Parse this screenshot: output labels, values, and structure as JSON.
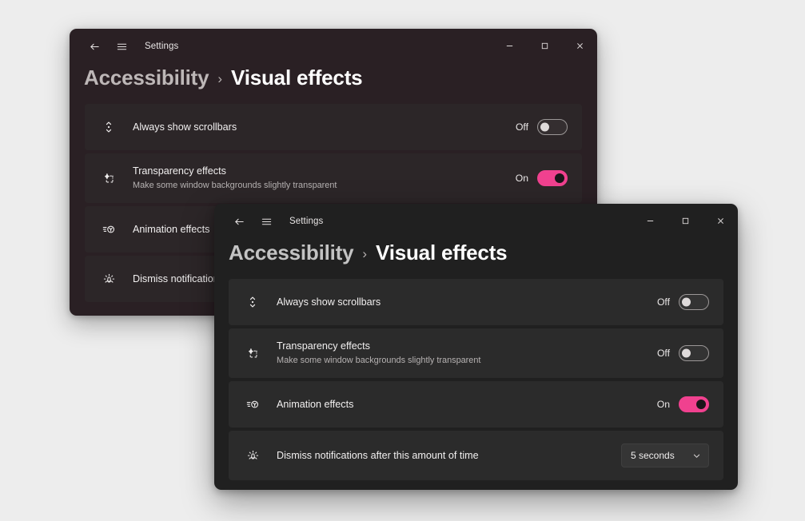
{
  "page": {
    "background_color": "#ededed"
  },
  "windows": {
    "back": {
      "titlebar": {
        "back_label": "back-arrow",
        "hamburger_label": "navigation-menu",
        "app_title": "Settings",
        "minimize": "─",
        "maximize": "□",
        "close": "×"
      },
      "breadcrumb": {
        "parent": "Accessibility",
        "separator": "›",
        "current": "Visual effects"
      },
      "rows": [
        {
          "icon": "scrollbar-icon",
          "title": "Always show scrollbars",
          "subtitle": "",
          "control": "toggle",
          "state_label": "Off",
          "state": "off"
        },
        {
          "icon": "transparency-icon",
          "title": "Transparency effects",
          "subtitle": "Make some window backgrounds slightly transparent",
          "control": "toggle",
          "state_label": "On",
          "state": "on"
        },
        {
          "icon": "animation-icon",
          "title": "Animation effects",
          "subtitle": "",
          "control": "toggle",
          "state_label": "",
          "state": "hidden"
        },
        {
          "icon": "notification-bell-icon",
          "title": "Dismiss notifications",
          "subtitle": "",
          "control": "dropdown",
          "state_label": "",
          "state": "hidden"
        }
      ],
      "colors": {
        "window_bg": "#2a2024",
        "card_bg": "#2c2628"
      }
    },
    "front": {
      "titlebar": {
        "back_label": "back-arrow",
        "hamburger_label": "navigation-menu",
        "app_title": "Settings",
        "minimize": "─",
        "maximize": "□",
        "close": "×"
      },
      "breadcrumb": {
        "parent": "Accessibility",
        "separator": "›",
        "current": "Visual effects"
      },
      "rows": [
        {
          "icon": "scrollbar-icon",
          "title": "Always show scrollbars",
          "subtitle": "",
          "control": "toggle",
          "state_label": "Off",
          "state": "off"
        },
        {
          "icon": "transparency-icon",
          "title": "Transparency effects",
          "subtitle": "Make some window backgrounds slightly transparent",
          "control": "toggle",
          "state_label": "Off",
          "state": "off"
        },
        {
          "icon": "animation-icon",
          "title": "Animation effects",
          "subtitle": "",
          "control": "toggle",
          "state_label": "On",
          "state": "on"
        },
        {
          "icon": "notification-bell-icon",
          "title": "Dismiss notifications after this amount of time",
          "subtitle": "",
          "control": "dropdown",
          "dropdown_value": "5 seconds",
          "state_label": "",
          "state": "none"
        }
      ],
      "colors": {
        "window_bg": "#202020",
        "card_bg": "#2b2b2b",
        "accent_on": "#f0418f"
      }
    }
  }
}
